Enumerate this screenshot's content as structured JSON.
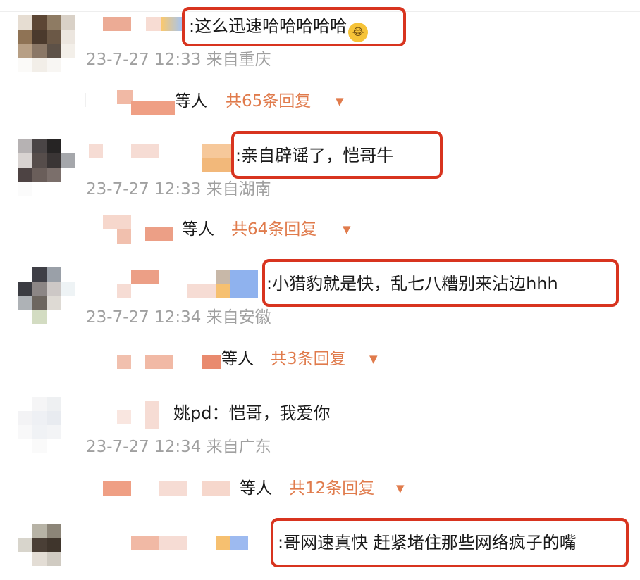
{
  "comments": [
    {
      "text": ":这么迅速哈哈哈哈哈",
      "emoji": "laughing-crying-emoji",
      "meta": "23-7-27 12:33 来自重庆",
      "reply_users": "等人",
      "reply_count": "共65条回复",
      "highlighted": true
    },
    {
      "text": ":亲自辟谣了，恺哥牛",
      "meta": "23-7-27 12:33 来自湖南",
      "reply_users": "等人",
      "reply_count": "共64条回复",
      "highlighted": true
    },
    {
      "text": ":小猎豹就是快，乱七八糟别来沾边hhh",
      "meta": "23-7-27 12:34 来自安徽",
      "reply_users": "等人",
      "reply_count": "共3条回复",
      "highlighted": true
    },
    {
      "text": "姚pd：恺哥，我爱你",
      "meta": "23-7-27 12:34 来自广东",
      "reply_users": "等人",
      "reply_count": "共12条回复",
      "highlighted": false
    },
    {
      "text": ":哥网速真快 赶紧堵住那些网络疯子的嘴",
      "highlighted": true
    }
  ],
  "icons": {
    "expand": "triangle-down-icon",
    "emoji": "laughing-crying-emoji"
  },
  "colors": {
    "highlight_box": "#d8341f",
    "reply_count": "#e07b4c",
    "meta_text": "#a0a0a0"
  }
}
